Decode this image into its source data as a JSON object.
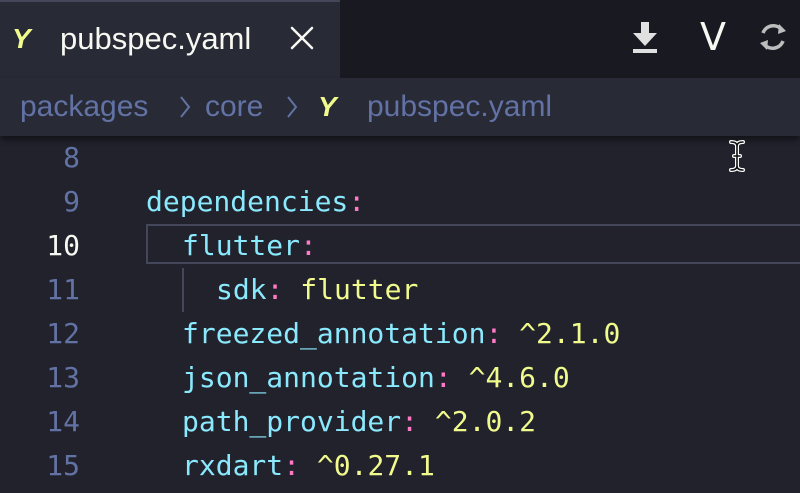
{
  "tab": {
    "icon_glyph": "Y",
    "label": "pubspec.yaml",
    "icon_color": "#f1fa8c"
  },
  "actions": {
    "download_icon": "download-icon",
    "v_label": "V",
    "sync_icon": "sync-icon"
  },
  "breadcrumb": {
    "items": [
      "packages",
      "core",
      "pubspec.yaml"
    ],
    "yaml_glyph": "Y"
  },
  "editor": {
    "lines": [
      {
        "number": "8",
        "key": "",
        "colon": "",
        "value": ""
      },
      {
        "number": "9",
        "key": "dependencies",
        "colon": ":",
        "value": ""
      },
      {
        "number": "10",
        "key": "flutter",
        "colon": ":",
        "value": ""
      },
      {
        "number": "11",
        "key": "sdk",
        "colon": ":",
        "value": " flutter"
      },
      {
        "number": "12",
        "key": "freezed_annotation",
        "colon": ":",
        "value": " ^2.1.0"
      },
      {
        "number": "13",
        "key": "json_annotation",
        "colon": ":",
        "value": " ^4.6.0"
      },
      {
        "number": "14",
        "key": "path_provider",
        "colon": ":",
        "value": " ^2.0.2"
      },
      {
        "number": "15",
        "key": "rxdart",
        "colon": ":",
        "value": " ^0.27.1"
      }
    ],
    "active_line": "10"
  },
  "colors": {
    "background": "#21222c",
    "tabbar": "#191a21",
    "key": "#8be9fd",
    "colon": "#ff79c6",
    "value": "#f1fa8c",
    "line_number": "#6272a4",
    "foreground": "#f8f8f2"
  }
}
